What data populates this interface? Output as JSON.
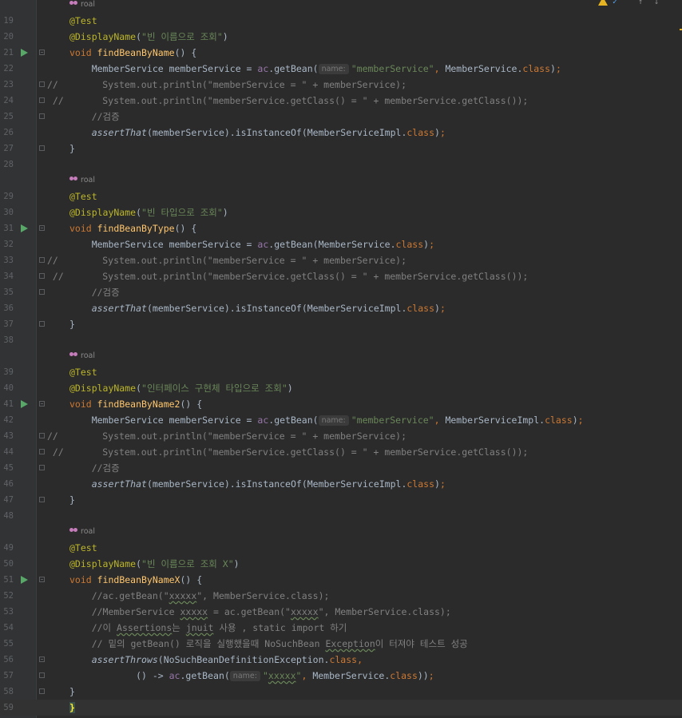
{
  "editor": {
    "author": "roal",
    "lines": [
      {
        "type": "author"
      },
      {
        "n": "19",
        "segs": [
          {
            "c": "ann",
            "t": "@Test"
          }
        ]
      },
      {
        "n": "20",
        "segs": [
          {
            "c": "ann",
            "t": "@DisplayName"
          },
          {
            "t": "("
          },
          {
            "c": "str",
            "t": "\"빈 이름으로 조회\""
          },
          {
            "t": ")"
          }
        ]
      },
      {
        "n": "21",
        "run": true,
        "fold": "open",
        "segs": [
          {
            "c": "kw",
            "t": "void "
          },
          {
            "c": "fn",
            "t": "findBeanByName"
          },
          {
            "t": "() {"
          }
        ]
      },
      {
        "n": "22",
        "segs": [
          {
            "t": "    MemberService memberService = "
          },
          {
            "c": "fld",
            "t": "ac"
          },
          {
            "t": ".getBean("
          },
          {
            "hint": "name:"
          },
          {
            "c": "str",
            "t": "\"memberService\""
          },
          {
            "c": "kw",
            "t": ", "
          },
          {
            "t": "MemberService."
          },
          {
            "c": "kw",
            "t": "class"
          },
          {
            "t": ")"
          },
          {
            "c": "kw",
            "t": ";"
          }
        ]
      },
      {
        "n": "23",
        "fold": "line",
        "cm": true,
        "segs": [
          {
            "c": "cm",
            "t": "//        System.out.println(\"memberService = \" + memberService);"
          }
        ]
      },
      {
        "n": "24",
        "fold": "line",
        "cm": true,
        "segs": [
          {
            "c": "cm",
            "t": " //       System.out.println(\"memberService.getClass() = \" + memberService.getClass());"
          }
        ]
      },
      {
        "n": "25",
        "fold": "line",
        "segs": [
          {
            "c": "cm",
            "t": "    //검증"
          }
        ]
      },
      {
        "n": "26",
        "segs": [
          {
            "t": "    "
          },
          {
            "c": "it",
            "t": "assertThat"
          },
          {
            "t": "(memberService).isInstanceOf(MemberServiceImpl."
          },
          {
            "c": "kw",
            "t": "class"
          },
          {
            "t": ")"
          },
          {
            "c": "kw",
            "t": ";"
          }
        ]
      },
      {
        "n": "27",
        "fold": "line",
        "segs": [
          {
            "t": "}"
          }
        ]
      },
      {
        "n": "28",
        "segs": []
      },
      {
        "type": "author"
      },
      {
        "n": "29",
        "segs": [
          {
            "c": "ann",
            "t": "@Test"
          }
        ]
      },
      {
        "n": "30",
        "segs": [
          {
            "c": "ann",
            "t": "@DisplayName"
          },
          {
            "t": "("
          },
          {
            "c": "str",
            "t": "\"빈 타입으로 조회\""
          },
          {
            "t": ")"
          }
        ]
      },
      {
        "n": "31",
        "run": true,
        "fold": "open",
        "segs": [
          {
            "c": "kw",
            "t": "void "
          },
          {
            "c": "fn",
            "t": "findBeanByType"
          },
          {
            "t": "() {"
          }
        ]
      },
      {
        "n": "32",
        "segs": [
          {
            "t": "    MemberService memberService = "
          },
          {
            "c": "fld",
            "t": "ac"
          },
          {
            "t": ".getBean(MemberService."
          },
          {
            "c": "kw",
            "t": "class"
          },
          {
            "t": ")"
          },
          {
            "c": "kw",
            "t": ";"
          }
        ]
      },
      {
        "n": "33",
        "fold": "line",
        "cm": true,
        "segs": [
          {
            "c": "cm",
            "t": "//        System.out.println(\"memberService = \" + memberService);"
          }
        ]
      },
      {
        "n": "34",
        "fold": "line",
        "cm": true,
        "segs": [
          {
            "c": "cm",
            "t": " //       System.out.println(\"memberService.getClass() = \" + memberService.getClass());"
          }
        ]
      },
      {
        "n": "35",
        "fold": "line",
        "segs": [
          {
            "c": "cm",
            "t": "    //검증"
          }
        ]
      },
      {
        "n": "36",
        "segs": [
          {
            "t": "    "
          },
          {
            "c": "it",
            "t": "assertThat"
          },
          {
            "t": "(memberService).isInstanceOf(MemberServiceImpl."
          },
          {
            "c": "kw",
            "t": "class"
          },
          {
            "t": ")"
          },
          {
            "c": "kw",
            "t": ";"
          }
        ]
      },
      {
        "n": "37",
        "fold": "line",
        "segs": [
          {
            "t": "}"
          }
        ]
      },
      {
        "n": "38",
        "segs": []
      },
      {
        "type": "author"
      },
      {
        "n": "39",
        "segs": [
          {
            "c": "ann",
            "t": "@Test"
          }
        ]
      },
      {
        "n": "40",
        "segs": [
          {
            "c": "ann",
            "t": "@DisplayName"
          },
          {
            "t": "("
          },
          {
            "c": "str",
            "t": "\"인터페이스 구현체 타입으로 조회\""
          },
          {
            "t": ")"
          }
        ]
      },
      {
        "n": "41",
        "run": true,
        "fold": "open",
        "segs": [
          {
            "c": "kw",
            "t": "void "
          },
          {
            "c": "fn",
            "t": "findBeanByName2"
          },
          {
            "t": "() {"
          }
        ]
      },
      {
        "n": "42",
        "segs": [
          {
            "t": "    MemberService memberService = "
          },
          {
            "c": "fld",
            "t": "ac"
          },
          {
            "t": ".getBean("
          },
          {
            "hint": "name:"
          },
          {
            "c": "str",
            "t": "\"memberService\""
          },
          {
            "c": "kw",
            "t": ", "
          },
          {
            "t": "MemberServiceImpl."
          },
          {
            "c": "kw",
            "t": "class"
          },
          {
            "t": ")"
          },
          {
            "c": "kw",
            "t": ";"
          }
        ]
      },
      {
        "n": "43",
        "fold": "line",
        "cm": true,
        "segs": [
          {
            "c": "cm",
            "t": "//        System.out.println(\"memberService = \" + memberService);"
          }
        ]
      },
      {
        "n": "44",
        "fold": "line",
        "cm": true,
        "segs": [
          {
            "c": "cm",
            "t": " //       System.out.println(\"memberService.getClass() = \" + memberService.getClass());"
          }
        ]
      },
      {
        "n": "45",
        "fold": "line",
        "segs": [
          {
            "c": "cm",
            "t": "    //검증"
          }
        ]
      },
      {
        "n": "46",
        "segs": [
          {
            "t": "    "
          },
          {
            "c": "it",
            "t": "assertThat"
          },
          {
            "t": "(memberService).isInstanceOf(MemberServiceImpl."
          },
          {
            "c": "kw",
            "t": "class"
          },
          {
            "t": ")"
          },
          {
            "c": "kw",
            "t": ";"
          }
        ]
      },
      {
        "n": "47",
        "fold": "line",
        "segs": [
          {
            "t": "}"
          }
        ]
      },
      {
        "n": "48",
        "segs": []
      },
      {
        "type": "author"
      },
      {
        "n": "49",
        "segs": [
          {
            "c": "ann",
            "t": "@Test"
          }
        ]
      },
      {
        "n": "50",
        "segs": [
          {
            "c": "ann",
            "t": "@DisplayName"
          },
          {
            "t": "("
          },
          {
            "c": "str",
            "t": "\"빈 이름으로 조회 X\""
          },
          {
            "t": ")"
          }
        ]
      },
      {
        "n": "51",
        "run": true,
        "fold": "open",
        "segs": [
          {
            "c": "kw",
            "t": "void "
          },
          {
            "c": "fn",
            "t": "findBeanByNameX"
          },
          {
            "t": "() {"
          }
        ]
      },
      {
        "n": "52",
        "segs": [
          {
            "c": "cm",
            "t": "    //ac.getBean(\""
          },
          {
            "c": "cm sq",
            "t": "xxxxx"
          },
          {
            "c": "cm",
            "t": "\", MemberService.class);"
          }
        ]
      },
      {
        "n": "53",
        "segs": [
          {
            "c": "cm",
            "t": "    //MemberService "
          },
          {
            "c": "cm sq",
            "t": "xxxxx"
          },
          {
            "c": "cm",
            "t": " = ac.getBean(\""
          },
          {
            "c": "cm sq",
            "t": "xxxxx"
          },
          {
            "c": "cm",
            "t": "\", MemberService.class);"
          }
        ]
      },
      {
        "n": "54",
        "segs": [
          {
            "c": "cm",
            "t": "    //이 "
          },
          {
            "c": "cm sq",
            "t": "Assertions"
          },
          {
            "c": "cm",
            "t": "는 "
          },
          {
            "c": "cm sq",
            "t": "jnuit"
          },
          {
            "c": "cm",
            "t": " 사용 , static import 하기"
          }
        ]
      },
      {
        "n": "55",
        "segs": [
          {
            "c": "cm",
            "t": "    // 밑의 getBean() 로직을 실행했을때 NoSuchBean "
          },
          {
            "c": "cm sq",
            "t": "Exception"
          },
          {
            "c": "cm",
            "t": "이 터져야 테스트 성공"
          }
        ]
      },
      {
        "n": "56",
        "fold": "open",
        "segs": [
          {
            "t": "    "
          },
          {
            "c": "it",
            "t": "assertThrows"
          },
          {
            "t": "(NoSuchBeanDefinitionException."
          },
          {
            "c": "kw",
            "t": "class"
          },
          {
            "c": "kw",
            "t": ","
          }
        ]
      },
      {
        "n": "57",
        "fold": "line",
        "segs": [
          {
            "t": "            () -> "
          },
          {
            "c": "fld",
            "t": "ac"
          },
          {
            "t": ".getBean("
          },
          {
            "hint": "name:"
          },
          {
            "c": "str",
            "t": "\""
          },
          {
            "c": "str sq",
            "t": "xxxxx"
          },
          {
            "c": "str",
            "t": "\""
          },
          {
            "c": "kw",
            "t": ", "
          },
          {
            "t": "MemberService."
          },
          {
            "c": "kw",
            "t": "class"
          },
          {
            "t": "))"
          },
          {
            "c": "kw",
            "t": ";"
          }
        ]
      },
      {
        "n": "58",
        "fold": "line",
        "segs": [
          {
            "t": "}"
          }
        ]
      },
      {
        "n": "59",
        "current": true,
        "segs": [
          {
            "c": "brace-hl",
            "t": "}"
          }
        ]
      }
    ]
  },
  "toolbar": {
    "icons": [
      "warning-icon",
      "inspection-icon",
      "prev-highlight-icon",
      "next-highlight-icon"
    ],
    "warning_color": "#e6b422",
    "arrow_up": "↑",
    "arrow_down": "↓",
    "inspect_glyph": "✓"
  },
  "colors": {
    "background": "#2b2b2b",
    "keyword": "#cc7832",
    "string": "#6a8759",
    "annotation": "#bbb529",
    "method": "#ffc66d",
    "field": "#9876aa",
    "comment": "#808080",
    "run_gutter": "#59a869"
  }
}
